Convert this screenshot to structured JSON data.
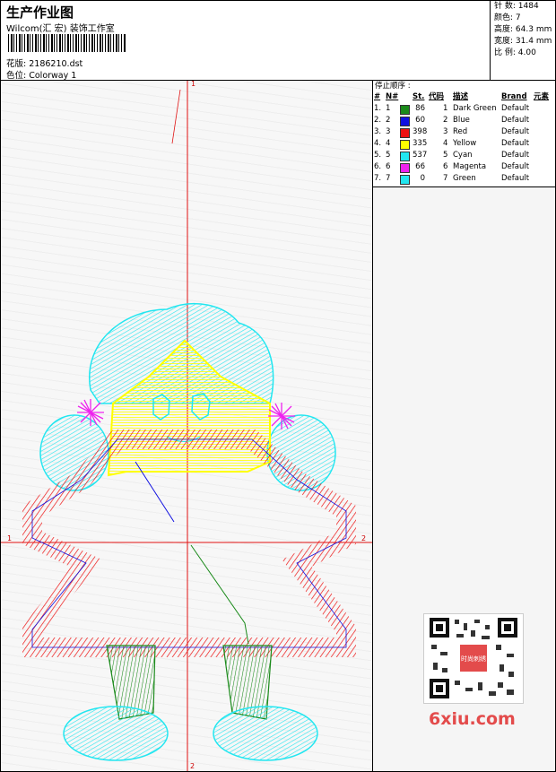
{
  "header": {
    "title": "生产作业图",
    "company": "Wilcom(汇 宏) 装饰工作室",
    "design_label": "花版:",
    "design_value": "2186210.dst",
    "color_label": "色位:",
    "color_value": "Colorway 1"
  },
  "stats": [
    {
      "label": "针 数:",
      "value": "1484"
    },
    {
      "label": "颜色:",
      "value": "7"
    },
    {
      "label": "高度:",
      "value": "64.3 mm"
    },
    {
      "label": "宽度:",
      "value": "31.4 mm"
    },
    {
      "label": "比 例:",
      "value": "4.00"
    }
  ],
  "stop_sequence": {
    "title": "停止顺序 :",
    "columns": [
      "#",
      "N#",
      "St.",
      "代码",
      "描述",
      "Brand",
      "元素"
    ],
    "rows": [
      {
        "idx": "1.",
        "n": "1",
        "color": "#1a8a1a",
        "st": "86",
        "code": "1",
        "desc": "Dark Green",
        "brand": "Default"
      },
      {
        "idx": "2.",
        "n": "2",
        "color": "#1010e0",
        "st": "60",
        "code": "2",
        "desc": "Blue",
        "brand": "Default"
      },
      {
        "idx": "3.",
        "n": "3",
        "color": "#ee1111",
        "st": "398",
        "code": "3",
        "desc": "Red",
        "brand": "Default"
      },
      {
        "idx": "4.",
        "n": "4",
        "color": "#ffff00",
        "st": "335",
        "code": "4",
        "desc": "Yellow",
        "brand": "Default"
      },
      {
        "idx": "5.",
        "n": "5",
        "color": "#22e6f0",
        "st": "537",
        "code": "5",
        "desc": "Cyan",
        "brand": "Default"
      },
      {
        "idx": "6.",
        "n": "6",
        "color": "#ee22ee",
        "st": "66",
        "code": "6",
        "desc": "Magenta",
        "brand": "Default"
      },
      {
        "idx": "7.",
        "n": "7",
        "color": "#22e6f0",
        "st": "0",
        "code": "7",
        "desc": "Green",
        "brand": "Default"
      }
    ]
  },
  "canvas": {
    "axis_top": "1",
    "axis_left": "1",
    "axis_right": "2",
    "axis_bottom": "2"
  },
  "watermark": {
    "text": "6xiu.com",
    "qr_badge": "时尚刺绣"
  }
}
